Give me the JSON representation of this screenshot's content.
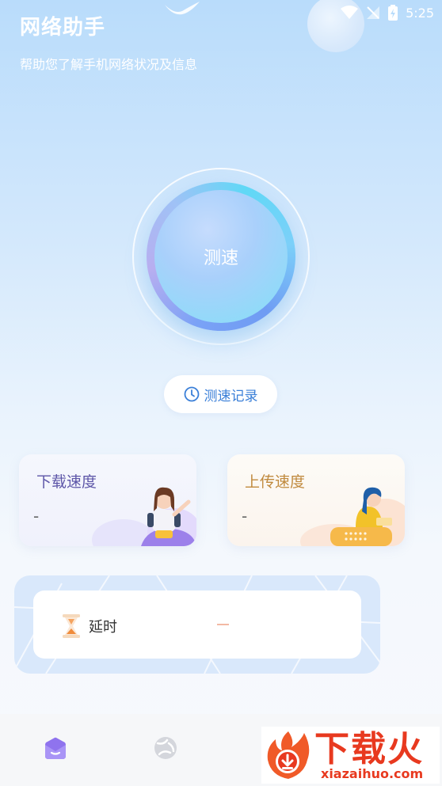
{
  "status_bar": {
    "time": "5:25"
  },
  "header": {
    "title": "网络助手",
    "subtitle": "帮助您了解手机网络状况及信息"
  },
  "speed_test": {
    "button_label": "测速",
    "records_label": "测速记录"
  },
  "cards": {
    "download": {
      "title": "下载速度",
      "value": "-"
    },
    "upload": {
      "title": "上传速度",
      "value": "-"
    }
  },
  "latency": {
    "label": "延时",
    "value": "—"
  },
  "nav": {
    "items": [
      "home-icon",
      "globe-icon"
    ]
  },
  "watermark": {
    "text": "下载火",
    "domain": "xiazaihuo.com"
  },
  "colors": {
    "accent_blue": "#3a7fd8",
    "download_title": "#5d56a8",
    "upload_title": "#c08a3e",
    "watermark_red": "#e8391f"
  }
}
